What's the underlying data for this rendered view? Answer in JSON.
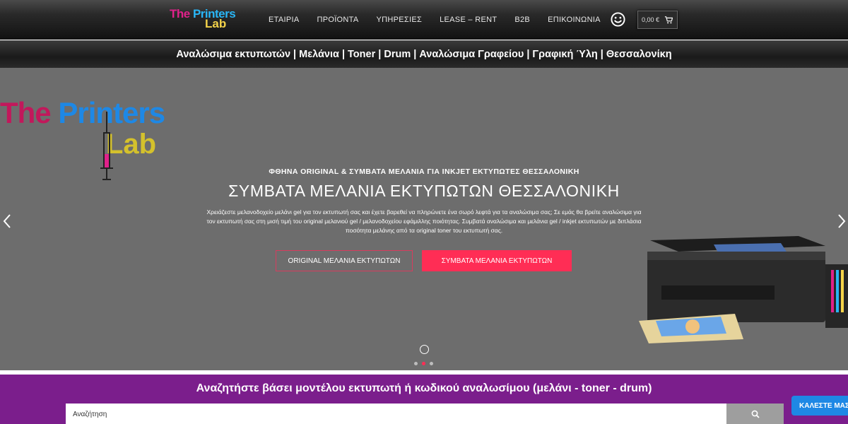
{
  "header": {
    "logo": {
      "word1": "The Printers",
      "word2": "Lab"
    },
    "nav": [
      "ΕΤΑΙΡΙΑ",
      "ΠΡΟΪΟΝΤΑ",
      "ΥΠΗΡΕΣΙΕΣ",
      "LEASE – RENT",
      "B2B",
      "ΕΠΙΚΟΙΝΩΝΙΑ"
    ],
    "cart_total": "0,00 €",
    "icons": {
      "account": "smiley-icon",
      "cart": "cart-icon"
    }
  },
  "tagline": "Αναλώσιμα εκτυπωτών | Μελάνια | Toner | Drum | Αναλώσιμα Γραφείου | Γραφική Ύλη | Θεσσαλονίκη",
  "hero": {
    "logo": {
      "word1": "The Printers",
      "word2": "Lab"
    },
    "kicker": "ΦΘΗΝΑ ORIGINAL & ΣΥΜΒΑΤΑ ΜΕΛΑΝΙΑ ΓΙΑ INKJET ΕΚΤΥΠΩΤΕΣ ΘΕΣΣΑΛΟΝΙΚΗ",
    "headline": "ΣΥΜΒΑΤΑ ΜΕΛΑΝΙΑ ΕΚΤΥΠΩΤΩΝ ΘΕΣΣΑΛΟΝΙΚΗ",
    "description": "Χρειάζεστε μελανοδοχείο μελάνι gel για τον εκτυπωτή σας και έχετε βαρεθεί να πληρώνετε ένα σωρό λεφτά για τα αναλώσιμα σας; Σε εμάς θα βρείτε αναλώσιμα για τον εκτυπωτή σας στη μισή τιμή του original μελανιού gel / μελανοδοχείου εφάμιλλης ποιότητας. Συμβατά αναλώσιμα και μελάνια gel / inkjet εκτυπωτών με διπλάσια ποσότητα μελάνης από τα original toner του εκτυπωτή σας.",
    "button_original": "ORIGINAL ΜΕΛΑΝΙΑ ΕΚΤΥΠΩΤΩΝ",
    "button_compatible": "ΣΥΜΒΑΤΑ ΜΕΛΑΝΙΑ ΕΚΤΥΠΩΤΩΝ",
    "slides_count": 3,
    "active_slide": 2,
    "colors": {
      "accent": "#ff2d55",
      "background": "#6d6d6d"
    }
  },
  "search": {
    "title": "Αναζητήστε βάσει μοντέλου εκτυπωτή ή κωδικού αναλωσίμου (μελάνι - toner - drum)",
    "placeholder": "Αναζήτηση",
    "background": "#7b1e8c"
  },
  "call_button": "ΚΑΛΕΣΤΕ ΜΑΣ"
}
